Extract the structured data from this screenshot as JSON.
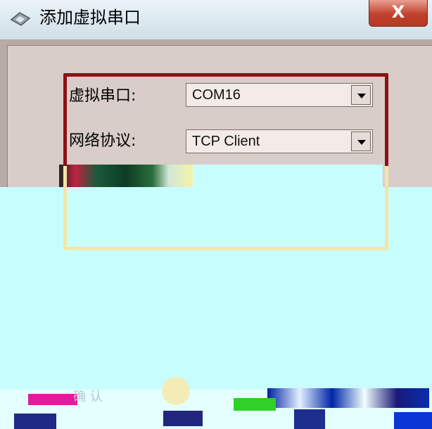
{
  "window": {
    "title": "添加虚拟串口",
    "close_label": "X"
  },
  "form": {
    "virtual_port_label": "虚拟串口:",
    "virtual_port_value": "COM16",
    "protocol_label": "网络协议:",
    "protocol_value": "TCP Client"
  },
  "footer": {
    "ok_label": "确 认"
  },
  "colors": {
    "groupbox_border": "#8f1016",
    "overlay": "#c8fdfd",
    "close_button": "#c0402c"
  }
}
